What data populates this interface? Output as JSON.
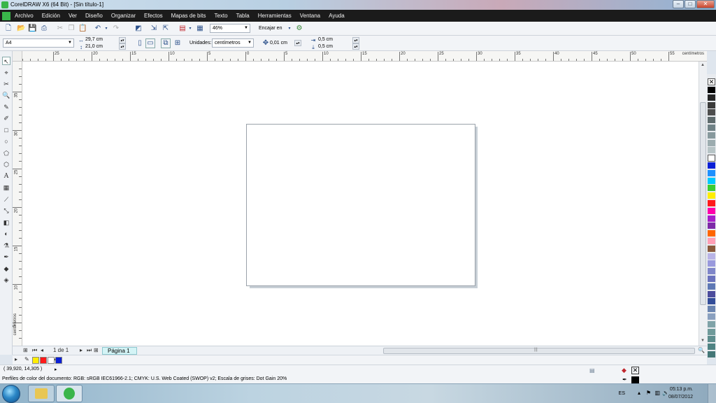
{
  "window": {
    "title": "CorelDRAW X6 (64 Bit) - [Sin título-1]",
    "buttons": [
      "–",
      "□",
      "✕"
    ]
  },
  "menu": [
    "Archivo",
    "Edición",
    "Ver",
    "Diseño",
    "Organizar",
    "Efectos",
    "Mapas de bits",
    "Texto",
    "Tabla",
    "Herramientas",
    "Ventana",
    "Ayuda"
  ],
  "standard_toolbar": {
    "zoom": "46%",
    "snap": "Encajar en"
  },
  "property_bar": {
    "page_size": "A4",
    "width": "29,7 cm",
    "height": "21,0 cm",
    "units_label": "Unidades:",
    "units": "centímetros",
    "nudge": "0,01 cm",
    "dup_x": "0,5 cm",
    "dup_y": "0,5 cm"
  },
  "rulers": {
    "unit": "centímetros",
    "h_labels": [
      "25",
      "20",
      "15",
      "10",
      "5",
      "0",
      "5",
      "10",
      "15",
      "20",
      "25",
      "30",
      "35",
      "40",
      "45",
      "50",
      "55"
    ],
    "v_labels": [
      "35",
      "30",
      "25",
      "20",
      "15",
      "10",
      "5",
      "0"
    ]
  },
  "page_nav": {
    "counter": "1 de 1",
    "tab": "Página 1"
  },
  "status": {
    "coords": "( 39,920, 14,305 )",
    "profiles": "Perfiles de color del documento: RGB: sRGB IEC61966-2.1; CMYK: U.S. Web Coated (SWOP) v2; Escala de grises: Dot Gain 20%"
  },
  "palette": [
    "#000000",
    "#262626",
    "#3b3b3b",
    "#4d4d4d",
    "#5f6b6d",
    "#708286",
    "#87999d",
    "#9cacaf",
    "#b7c4c6",
    "#ffffff",
    "#0a1fd6",
    "#1e90ff",
    "#00c8ff",
    "#3ccc33",
    "#ffee00",
    "#ff1a1a",
    "#ff00aa",
    "#a61fc9",
    "#7d2aa8",
    "#ff6600",
    "#ff9fb6",
    "#8a5a3c",
    "#b9b4e6",
    "#9999dd",
    "#7f86c9",
    "#6a72bd",
    "#5e78b5",
    "#4c4c9c",
    "#334d99",
    "#6a84b0",
    "#8aa0bf",
    "#7fa3a8",
    "#6f9a9a",
    "#5e8e8e",
    "#4f8383",
    "#447777"
  ],
  "doc_palette": [
    "#ffee00",
    "#ff1a1a",
    "#ffffff",
    "#0a1fd6"
  ],
  "taskbar": {
    "lang": "ES",
    "time": "05:13 p.m.",
    "date": "08/07/2012"
  }
}
